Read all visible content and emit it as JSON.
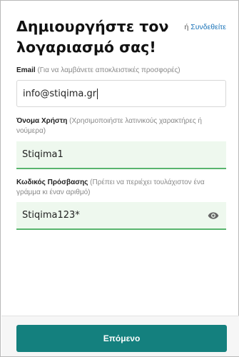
{
  "form": {
    "title": "Δημιουργήστε τον λογαριασμό σας!",
    "login_prefix": "ή",
    "login_link": "Συνδεθείτε",
    "email": {
      "label": "Email",
      "hint": "(Για να λαμβάνετε αποκλειστικές προσφορές)",
      "value": "info@stiqima.gr"
    },
    "username": {
      "label": "Όνομα Χρήστη",
      "hint": "(Χρησιμοποιήστε λατινικούς χαρακτήρες ή νούμερα)",
      "value": "Stiqima1"
    },
    "password": {
      "label": "Κωδικός Πρόσβασης",
      "hint": "(Πρέπει να περιέχει τουλάχιστον ένα γράμμα κι έναν αριθμό)",
      "value": "Stiqima123*",
      "toggle_icon": "eye-icon"
    },
    "next_button": "Επόμενο"
  },
  "colors": {
    "accent": "#14807e",
    "link": "#1a73b8",
    "valid_border": "#59b56e",
    "valid_bg": "#eef8ee"
  }
}
